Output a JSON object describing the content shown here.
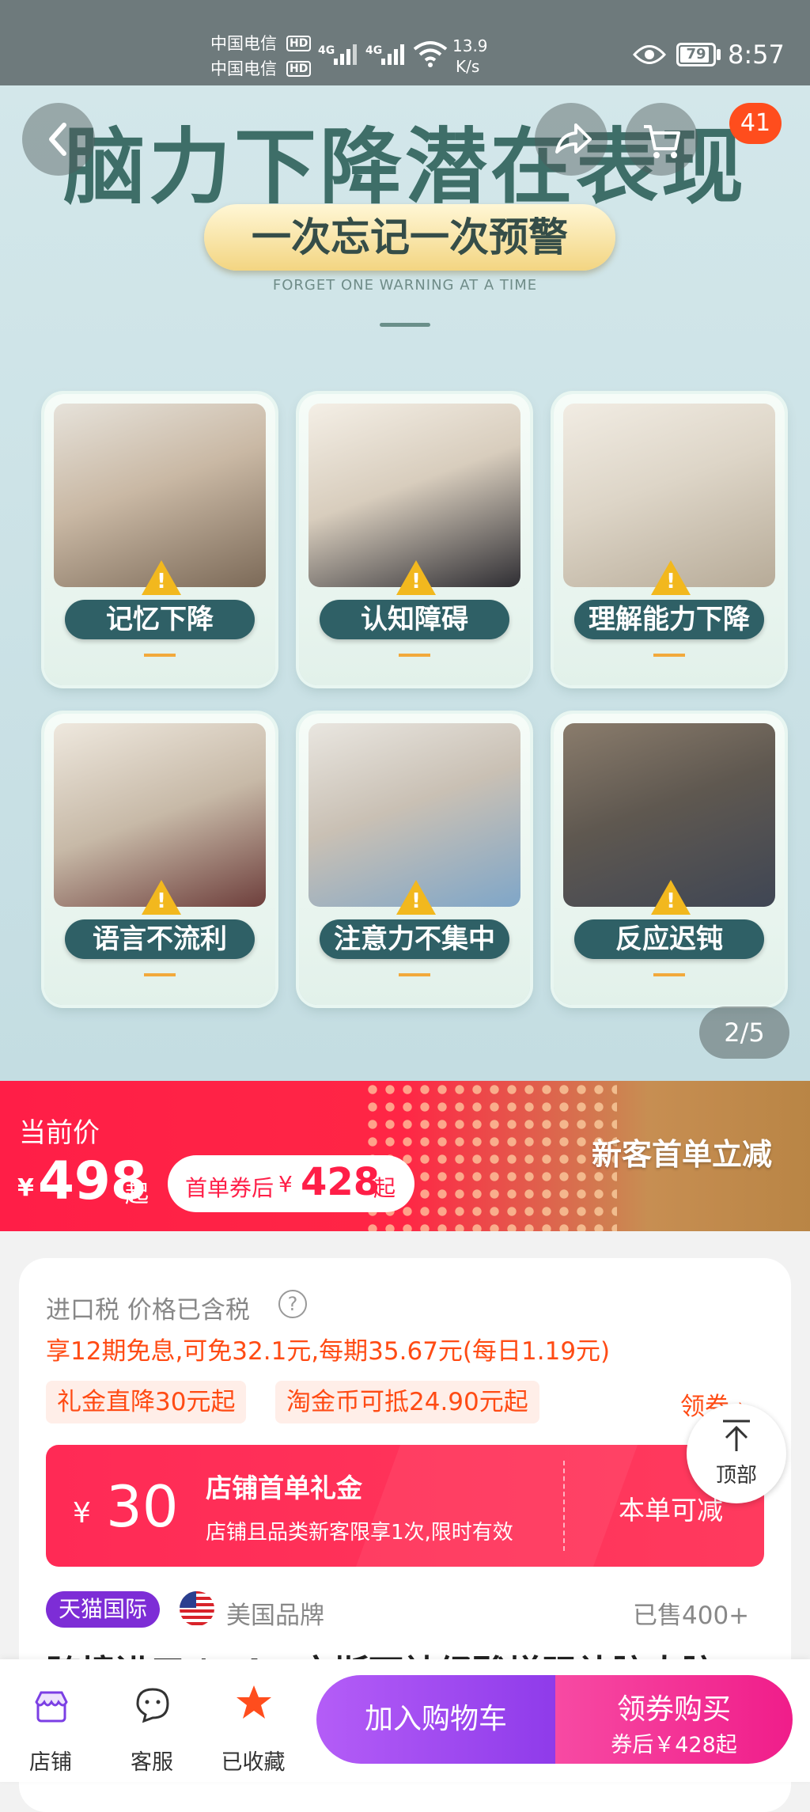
{
  "status_bar": {
    "carrier1": "中国电信",
    "carrier2": "中国电信",
    "hd": "HD",
    "net": "4G",
    "speed_value": "13.9",
    "speed_unit": "K/s",
    "battery": "79",
    "time": "8:57"
  },
  "header": {
    "cart_badge": "41"
  },
  "hero": {
    "title": "脑力下降潜在表现",
    "ribbon": "一次忘记一次预警",
    "subtitle": "FORGET ONE WARNING AT A TIME",
    "cards": [
      {
        "label": "记忆下降"
      },
      {
        "label": "认知障碍"
      },
      {
        "label": "理解能力下降"
      },
      {
        "label": "语言不流利"
      },
      {
        "label": "注意力不集中"
      },
      {
        "label": "反应迟钝"
      }
    ],
    "pager": "2/5"
  },
  "price": {
    "current_label": "当前价",
    "currency": "¥",
    "price": "498",
    "suffix": "起",
    "coupon_prefix": "首单券后",
    "coupon_currency": "¥",
    "coupon_price": "428",
    "coupon_suffix": "起",
    "promo": "新客首单立减"
  },
  "details": {
    "tax_text": "进口税 价格已含税",
    "installment": "享12期免息,可免32.1元,每期35.67元(每日1.19元)",
    "tag1": "礼金直降30元起",
    "tag2": "淘金币可抵24.90元起",
    "coupon_link": "领券",
    "top_label": "顶部",
    "coupon": {
      "currency": "¥",
      "amount": "30",
      "title": "店铺首单礼金",
      "desc": "店铺且品类新客限享1次,限时有效",
      "action": "本单可减"
    },
    "tmall_badge": "天猫国际",
    "brand_origin": "美国品牌",
    "sold": "已售400+",
    "product_title_partial": "跨境进口 | Vi.. 文斯可神经酸增强补脑大脑"
  },
  "bottom_bar": {
    "shop": "店铺",
    "service": "客服",
    "favorited": "已收藏",
    "add_cart": "加入购物车",
    "buy_label": "领券购买",
    "buy_sub": "券后￥428起"
  },
  "colors": {
    "accent_red": "#ff1e47",
    "purple": "#9b3bf0",
    "magenta": "#f01d8a",
    "orange_text": "#ff4b14",
    "teal_pill": "#2f6066"
  }
}
